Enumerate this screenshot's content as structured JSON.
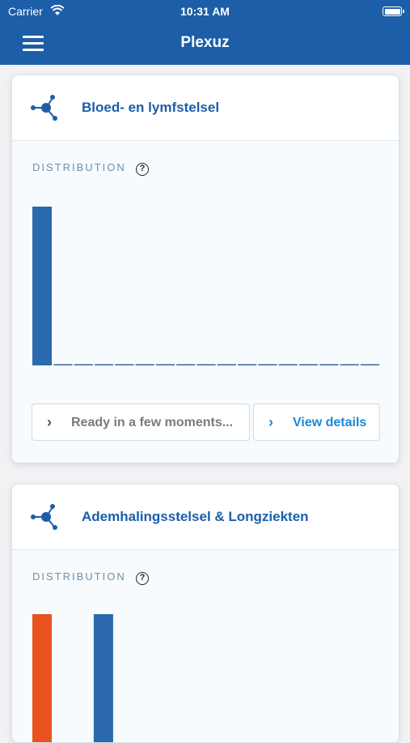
{
  "status_bar": {
    "carrier": "Carrier",
    "time": "10:31 AM"
  },
  "navbar": {
    "title": "Plexuz"
  },
  "colors": {
    "brand": "#1c5ea8",
    "bar_blue": "#2a6aad",
    "bar_orange": "#e8521f",
    "link": "#1c8ad6"
  },
  "cards": [
    {
      "title": "Bloed- en lymfstelsel",
      "distribution_label": "DISTRIBUTION",
      "buttons": {
        "ready": "Ready in a few moments...",
        "details": "View details"
      },
      "chart_data": {
        "type": "bar",
        "values": [
          1,
          0,
          0,
          0,
          0,
          0,
          0,
          0,
          0,
          0,
          0,
          0,
          0,
          0,
          0,
          0,
          0
        ],
        "colors": [
          "#2a6aad"
        ],
        "ylim": [
          0,
          1
        ]
      }
    },
    {
      "title": "Ademhalingsstelsel & Longziekten",
      "distribution_label": "DISTRIBUTION",
      "chart_data": {
        "type": "bar",
        "values": [
          1,
          0,
          0,
          1
        ],
        "colors": [
          "#e8521f",
          "#2a6aad",
          "#2a6aad",
          "#2a6aad"
        ],
        "ylim": [
          0,
          1
        ]
      }
    }
  ]
}
